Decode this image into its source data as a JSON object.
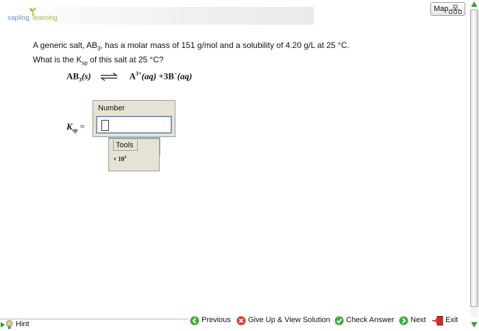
{
  "header": {
    "logo_word_1": "sapling",
    "logo_word_2": "learning",
    "map_label": "Map"
  },
  "question": {
    "line1_pre": "A generic salt, AB",
    "line1_sub": "3",
    "line1_post": ", has a molar mass of 151 g/mol and a solubility of 4.20 g/L at 25 °C.",
    "line2_pre": "What is the K",
    "line2_sub": "sp",
    "line2_post": " of this salt at 25 °C?"
  },
  "equation": {
    "reactant": "AB",
    "reactant_sub": "3",
    "reactant_state": "(s)",
    "product1": "A",
    "product1_charge": "3+",
    "product1_state": "(aq)",
    "plus": "+",
    "product2": "3B",
    "product2_charge": "−",
    "product2_state": "(aq)"
  },
  "answer": {
    "variable": "K",
    "variable_sub": "sp",
    "equals": "=",
    "number_label": "Number",
    "number_value": "",
    "tools_label": "Tools",
    "sci_button_base": "× 10",
    "sci_button_exp": "3"
  },
  "footer": {
    "hint": "Hint",
    "previous": "Previous",
    "give_up": "Give Up & View Solution",
    "check_answer": "Check Answer",
    "next": "Next",
    "exit": "Exit"
  },
  "colors": {
    "panel_bg": "#e6e3d6",
    "input_border": "#7f9ab8",
    "tools_band": "#9ab3cc",
    "nav_green": "#3cae3c",
    "nav_red": "#d83a2a",
    "scroll_arrow": "#2fa52f"
  },
  "icons": [
    "sapling-leaf-icon",
    "map-tree-icon",
    "hint-lightbulb-icon",
    "previous-arrow-icon",
    "give-up-x-icon",
    "check-mark-icon",
    "next-arrow-icon",
    "exit-door-icon",
    "scroll-up-arrow-icon",
    "scroll-down-arrow-icon"
  ]
}
